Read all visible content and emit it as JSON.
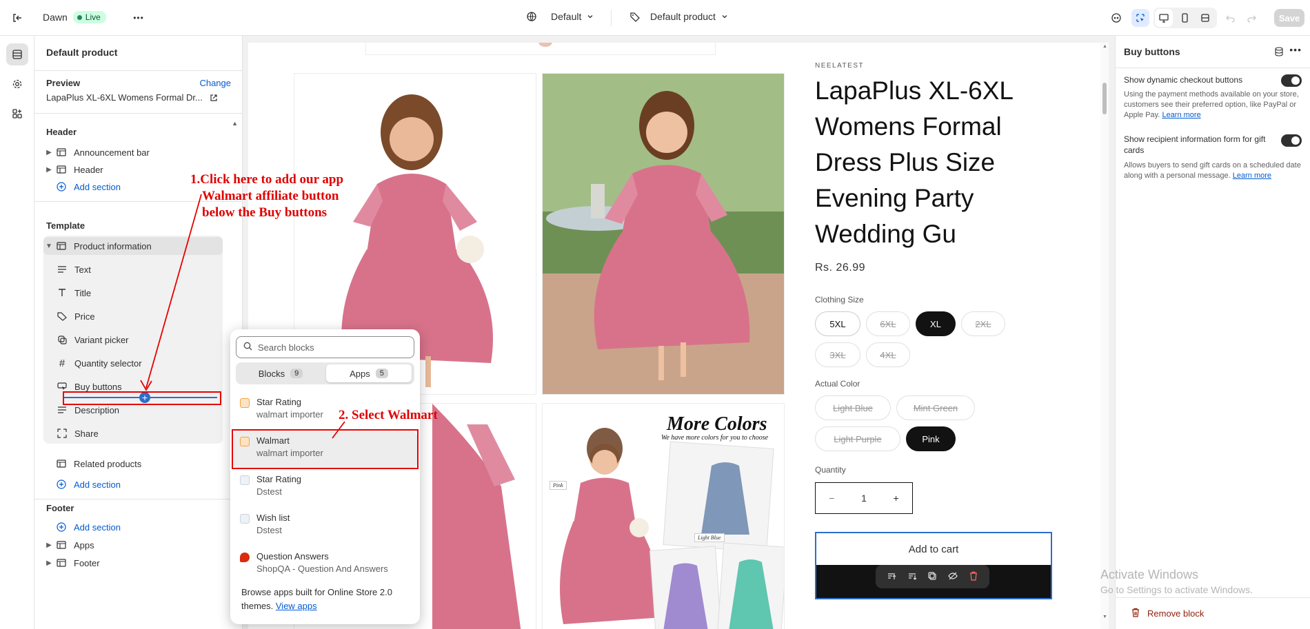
{
  "topbar": {
    "theme_name": "Dawn",
    "status_badge": "Live",
    "more_label": "•••",
    "template_selector": "Default",
    "product_selector": "Default product",
    "save_label": "Save"
  },
  "left_panel": {
    "title": "Default product",
    "preview_label": "Preview",
    "change_link": "Change",
    "preview_product": "LapaPlus XL-6XL Womens Formal Dr...",
    "header_section": "Header",
    "header_items": [
      "Announcement bar",
      "Header"
    ],
    "add_section": "Add section",
    "template_section": "Template",
    "product_info": "Product information",
    "blocks": [
      "Text",
      "Title",
      "Price",
      "Variant picker",
      "Quantity selector",
      "Buy buttons",
      "Description",
      "Share"
    ],
    "related_products": "Related products",
    "footer_section": "Footer",
    "footer_items": [
      "Apps",
      "Footer"
    ]
  },
  "block_picker": {
    "search_placeholder": "Search blocks",
    "tabs": [
      {
        "label": "Blocks",
        "count": "9"
      },
      {
        "label": "Apps",
        "count": "5"
      }
    ],
    "items": [
      {
        "name": "Star Rating",
        "source": "walmart importer",
        "icon_color": "#f4a340"
      },
      {
        "name": "Walmart",
        "source": "walmart importer",
        "icon_color": "#f4a340"
      },
      {
        "name": "Star Rating",
        "source": "Dstest",
        "icon_color": "#c9d3e0"
      },
      {
        "name": "Wish list",
        "source": "Dstest",
        "icon_color": "#c9d3e0"
      },
      {
        "name": "Question Answers",
        "source": "ShopQA - Question And Answers",
        "icon_color": "#d82c0d"
      }
    ],
    "footer_text": "Browse apps built for Online Store 2.0 themes.",
    "footer_link": "View apps"
  },
  "product": {
    "brand": "NEELATEST",
    "title": "LapaPlus XL-6XL Womens Formal Dress Plus Size Evening Party Wedding Gu",
    "price": "Rs. 26.99",
    "size_label": "Clothing Size",
    "sizes": [
      {
        "label": "5XL",
        "state": "available"
      },
      {
        "label": "6XL",
        "state": "unavailable"
      },
      {
        "label": "XL",
        "state": "selected"
      },
      {
        "label": "2XL",
        "state": "unavailable"
      },
      {
        "label": "3XL",
        "state": "unavailable"
      },
      {
        "label": "4XL",
        "state": "unavailable"
      }
    ],
    "color_label": "Actual Color",
    "colors": [
      {
        "label": "Light Blue",
        "state": "unavailable"
      },
      {
        "label": "Mint Green",
        "state": "unavailable"
      },
      {
        "label": "Light Purple",
        "state": "unavailable"
      },
      {
        "label": "Pink",
        "state": "selected"
      }
    ],
    "quantity_label": "Quantity",
    "quantity": "1",
    "minus": "−",
    "plus": "+",
    "add_to_cart": "Add to cart",
    "more_colors_title": "More Colors",
    "more_colors_sub": "We have more colors for you to choose",
    "swatch_labels": [
      "Pink",
      "Light Blue"
    ]
  },
  "right_panel": {
    "title": "Buy buttons",
    "setting1_label": "Show dynamic checkout buttons",
    "setting1_help": "Using the payment methods available on your store, customers see their preferred option, like PayPal or Apple Pay.",
    "setting2_label": "Show recipient information form for gift cards",
    "setting2_help": "Allows buyers to send gift cards on a scheduled date along with a personal message.",
    "learn_more": "Learn more",
    "remove_block": "Remove block"
  },
  "watermark": {
    "line1": "Activate Windows",
    "line2": "Go to Settings to activate Windows."
  },
  "annotations": {
    "step1_line1": "1.Click here to add our app",
    "step1_line2": "Walmart affiliate button",
    "step1_line3": "below the Buy buttons",
    "step2": "2. Select Walmart"
  },
  "colors": {
    "accent": "#005bd3",
    "annotation_red": "#e00000",
    "selection_blue": "#2c6ecb",
    "dress_pink": "#d8728a"
  }
}
